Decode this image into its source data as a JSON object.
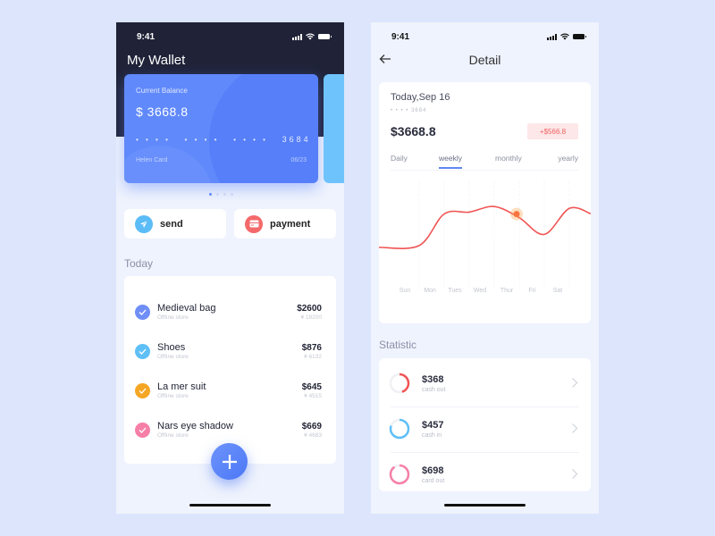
{
  "wallet": {
    "status": {
      "time": "9:41"
    },
    "title": "My Wallet",
    "card": {
      "label": "Current Balance",
      "balance": "$ 3668.8",
      "masked_groups": [
        "• • • •",
        "• • • •",
        "• • • •"
      ],
      "last4": "3684",
      "holder": "Helen  Card",
      "expiry": "06/23",
      "color": "#6089fb"
    },
    "carousel": {
      "count": 4,
      "active": 0
    },
    "actions": [
      {
        "label": "send",
        "icon": "paper-plane-icon",
        "color": "#5bbcf7"
      },
      {
        "label": "payment",
        "icon": "card-icon",
        "color": "#f5696a"
      }
    ],
    "section_label": "Today",
    "transactions": [
      {
        "name": "Medieval bag",
        "sub": "Offline store",
        "amount": "$2600",
        "cny": "¥ 18200",
        "color": "#6f8ef6"
      },
      {
        "name": "Shoes",
        "sub": "Offline store",
        "amount": "$876",
        "cny": "¥ 6132",
        "color": "#5fc0f7"
      },
      {
        "name": "La mer suit",
        "sub": "Offline store",
        "amount": "$645",
        "cny": "¥ 4515",
        "color": "#f5a623"
      },
      {
        "name": "Nars eye shadow",
        "sub": "Offline store",
        "amount": "$669",
        "cny": "¥ 4683",
        "color": "#f67fa8"
      }
    ],
    "fab_icon": "plus-icon"
  },
  "detail": {
    "status": {
      "time": "9:41"
    },
    "title": "Detail",
    "date": "Today,Sep 16",
    "card_masked": "• • • •  3684",
    "total": "$3668.8",
    "delta": "+$566.8",
    "tabs": [
      {
        "label": "Daily",
        "active": false
      },
      {
        "label": "weekly",
        "active": true
      },
      {
        "label": "monthly",
        "active": false
      },
      {
        "label": "yearly",
        "active": false
      }
    ],
    "chart_data": {
      "type": "line",
      "categories": [
        "Sun",
        "Mon",
        "Tues",
        "Wed",
        "Thur",
        "Fri",
        "Sat"
      ],
      "values": [
        28,
        62,
        64,
        70,
        58,
        40,
        68
      ],
      "highlight_index": 4,
      "line_color": "#f05454",
      "highlight_color": "#f9a34b",
      "grid": "vertical-dotted"
    },
    "statistic_label": "Statistic",
    "stats": [
      {
        "value": "$368",
        "label": "cash out",
        "fraction": 0.45,
        "color": "#f05454"
      },
      {
        "value": "$457",
        "label": "cash in",
        "fraction": 0.8,
        "color": "#5fc0f7"
      },
      {
        "value": "$698",
        "label": "card out",
        "fraction": 0.9,
        "color": "#f67fa8"
      }
    ]
  }
}
